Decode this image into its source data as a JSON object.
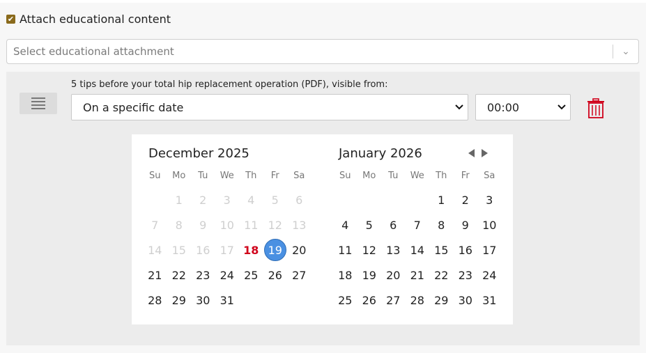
{
  "attach": {
    "checkbox_checked": true,
    "check_glyph": "✔",
    "label": "Attach educational content"
  },
  "attachment_select": {
    "placeholder": "Select educational attachment",
    "chevron": "⌄"
  },
  "item": {
    "label": "5 tips before your total hip replacement operation (PDF), visible from:",
    "visibility_value": "On a specific date",
    "time_value": "00:00",
    "caret": "⌄"
  },
  "calendar": {
    "today_color": "#d0021b",
    "selected_color": "#4a90e2",
    "months": [
      {
        "title": "December 2025",
        "dow": [
          "Su",
          "Mo",
          "Tu",
          "We",
          "Th",
          "Fr",
          "Sa"
        ],
        "weeks": [
          [
            {
              "d": ""
            },
            {
              "d": "1",
              "s": "disabled"
            },
            {
              "d": "2",
              "s": "disabled"
            },
            {
              "d": "3",
              "s": "disabled"
            },
            {
              "d": "4",
              "s": "disabled"
            },
            {
              "d": "5",
              "s": "disabled"
            },
            {
              "d": "6",
              "s": "disabled"
            }
          ],
          [
            {
              "d": "7",
              "s": "disabled"
            },
            {
              "d": "8",
              "s": "disabled"
            },
            {
              "d": "9",
              "s": "disabled"
            },
            {
              "d": "10",
              "s": "disabled"
            },
            {
              "d": "11",
              "s": "disabled"
            },
            {
              "d": "12",
              "s": "disabled"
            },
            {
              "d": "13",
              "s": "disabled"
            }
          ],
          [
            {
              "d": "14",
              "s": "disabled"
            },
            {
              "d": "15",
              "s": "disabled"
            },
            {
              "d": "16",
              "s": "disabled"
            },
            {
              "d": "17",
              "s": "disabled"
            },
            {
              "d": "18",
              "s": "today"
            },
            {
              "d": "19",
              "s": "selected"
            },
            {
              "d": "20"
            }
          ],
          [
            {
              "d": "21"
            },
            {
              "d": "22"
            },
            {
              "d": "23"
            },
            {
              "d": "24"
            },
            {
              "d": "25"
            },
            {
              "d": "26"
            },
            {
              "d": "27"
            }
          ],
          [
            {
              "d": "28"
            },
            {
              "d": "29"
            },
            {
              "d": "30"
            },
            {
              "d": "31"
            },
            {
              "d": ""
            },
            {
              "d": ""
            },
            {
              "d": ""
            }
          ]
        ]
      },
      {
        "title": "January 2026",
        "dow": [
          "Su",
          "Mo",
          "Tu",
          "We",
          "Th",
          "Fr",
          "Sa"
        ],
        "weeks": [
          [
            {
              "d": ""
            },
            {
              "d": ""
            },
            {
              "d": ""
            },
            {
              "d": ""
            },
            {
              "d": "1"
            },
            {
              "d": "2"
            },
            {
              "d": "3"
            }
          ],
          [
            {
              "d": "4"
            },
            {
              "d": "5"
            },
            {
              "d": "6"
            },
            {
              "d": "7"
            },
            {
              "d": "8"
            },
            {
              "d": "9"
            },
            {
              "d": "10"
            }
          ],
          [
            {
              "d": "11"
            },
            {
              "d": "12"
            },
            {
              "d": "13"
            },
            {
              "d": "14"
            },
            {
              "d": "15"
            },
            {
              "d": "16"
            },
            {
              "d": "17"
            }
          ],
          [
            {
              "d": "18"
            },
            {
              "d": "19"
            },
            {
              "d": "20"
            },
            {
              "d": "21"
            },
            {
              "d": "22"
            },
            {
              "d": "23"
            },
            {
              "d": "24"
            }
          ],
          [
            {
              "d": "25"
            },
            {
              "d": "26"
            },
            {
              "d": "27"
            },
            {
              "d": "28"
            },
            {
              "d": "29"
            },
            {
              "d": "30"
            },
            {
              "d": "31"
            }
          ]
        ]
      }
    ]
  }
}
